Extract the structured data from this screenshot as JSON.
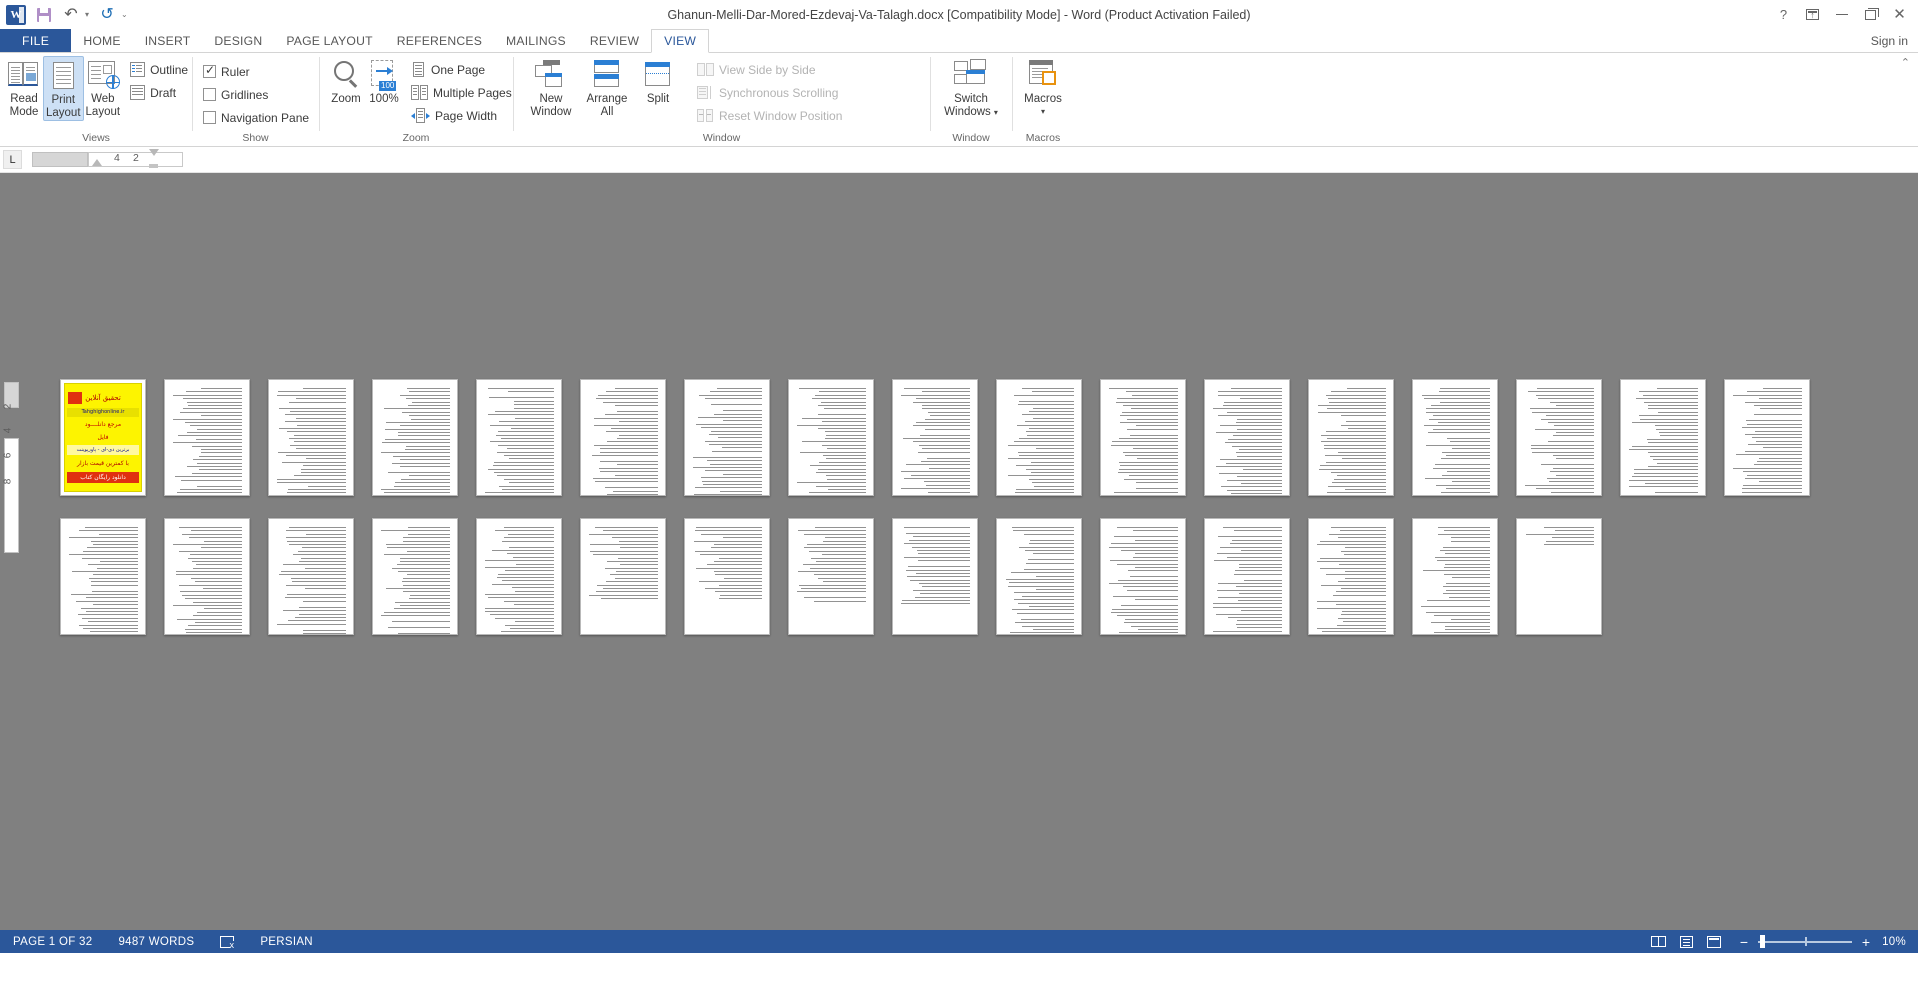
{
  "window": {
    "title": "Ghanun-Melli-Dar-Mored-Ezdevaj-Va-Talagh.docx [Compatibility Mode] - Word (Product Activation Failed)",
    "help_label": "?",
    "ribbon_display_label": "",
    "minimize_label": "",
    "restore_label": "",
    "close_label": "✕",
    "signin_label": "Sign in"
  },
  "qat": {
    "save_label": "",
    "undo_label": "↶",
    "redo_label": "↺",
    "customize_label": "⌄"
  },
  "tabs": [
    {
      "label": "FILE"
    },
    {
      "label": "HOME"
    },
    {
      "label": "INSERT"
    },
    {
      "label": "DESIGN"
    },
    {
      "label": "PAGE LAYOUT"
    },
    {
      "label": "REFERENCES"
    },
    {
      "label": "MAILINGS"
    },
    {
      "label": "REVIEW"
    },
    {
      "label": "VIEW"
    }
  ],
  "active_tab": "VIEW",
  "ribbon": {
    "groups": [
      {
        "name": "Views",
        "label": "Views",
        "buttons": [
          {
            "label_line1": "Read",
            "label_line2": "Mode",
            "selected": false
          },
          {
            "label_line1": "Print",
            "label_line2": "Layout",
            "selected": true
          },
          {
            "label_line1": "Web",
            "label_line2": "Layout",
            "selected": false
          }
        ],
        "small_items": [
          {
            "label": "Outline",
            "icon": "outline-icon",
            "disabled": false
          },
          {
            "label": "Draft",
            "icon": "draft-icon",
            "disabled": false
          }
        ]
      },
      {
        "name": "Show",
        "label": "Show",
        "checkboxes": [
          {
            "label": "Ruler",
            "checked": true
          },
          {
            "label": "Gridlines",
            "checked": false
          },
          {
            "label": "Navigation Pane",
            "checked": false
          }
        ]
      },
      {
        "name": "Zoom",
        "label": "Zoom",
        "buttons": [
          {
            "label_line1": "Zoom",
            "label_line2": "",
            "icon": "magnifier-icon"
          },
          {
            "label_line1": "100%",
            "label_line2": "",
            "icon": "zoom-100-icon"
          }
        ],
        "small_items": [
          {
            "label": "One Page",
            "icon": "one-page-icon"
          },
          {
            "label": "Multiple Pages",
            "icon": "multiple-pages-icon"
          },
          {
            "label": "Page Width",
            "icon": "page-width-icon"
          }
        ]
      },
      {
        "name": "Window",
        "label": "Window",
        "buttons": [
          {
            "label_line1": "New",
            "label_line2": "Window",
            "icon": "new-window-icon"
          },
          {
            "label_line1": "Arrange",
            "label_line2": "All",
            "icon": "arrange-all-icon"
          },
          {
            "label_line1": "Split",
            "label_line2": "",
            "icon": "split-icon"
          }
        ],
        "small_items": [
          {
            "label": "View Side by Side",
            "icon": "side-by-side-icon",
            "disabled": true
          },
          {
            "label": "Synchronous Scrolling",
            "icon": "sync-scroll-icon",
            "disabled": true
          },
          {
            "label": "Reset Window Position",
            "icon": "reset-window-icon",
            "disabled": true
          }
        ]
      },
      {
        "name": "SwitchWindows",
        "label": "Window",
        "buttons": [
          {
            "label_line1": "Switch",
            "label_line2": "Windows",
            "icon": "switch-windows-icon",
            "has_caret": true
          }
        ]
      },
      {
        "name": "Macros",
        "label": "Macros",
        "buttons": [
          {
            "label_line1": "Macros",
            "label_line2": "",
            "icon": "macros-icon",
            "has_caret": true
          }
        ]
      }
    ],
    "collapse_label": "⌃"
  },
  "ruler": {
    "tab_selector_label": "L",
    "marks": [
      "4",
      "2"
    ]
  },
  "document": {
    "page_count_visible": 32,
    "vertical_ruler_marks": [
      "2",
      "4",
      "6",
      "8"
    ],
    "cover_page": {
      "lines": [
        "تحقیق آنلاین",
        "Tahghighonline.ir",
        "مرجع دانلــــود",
        "فایل",
        "برترین دی-ای - پاورپوینت",
        "با کمترین قیمت بازار",
        "دانلود رایگان کتاب"
      ]
    }
  },
  "statusbar": {
    "page_label": "PAGE 1 OF 32",
    "words_label": "9487 WORDS",
    "proofing_icon": "proofing-errors-icon",
    "language_label": "PERSIAN",
    "view_read_label": "",
    "view_print_label": "",
    "view_web_label": "",
    "zoom_out_label": "−",
    "zoom_in_label": "+",
    "zoom_level": "10%"
  },
  "colors": {
    "brand": "#2b579a",
    "accent": "#1f6fb5",
    "selected_bg": "#cde0f5",
    "canvas": "#808080",
    "disabled_text": "#b3b3b3"
  }
}
